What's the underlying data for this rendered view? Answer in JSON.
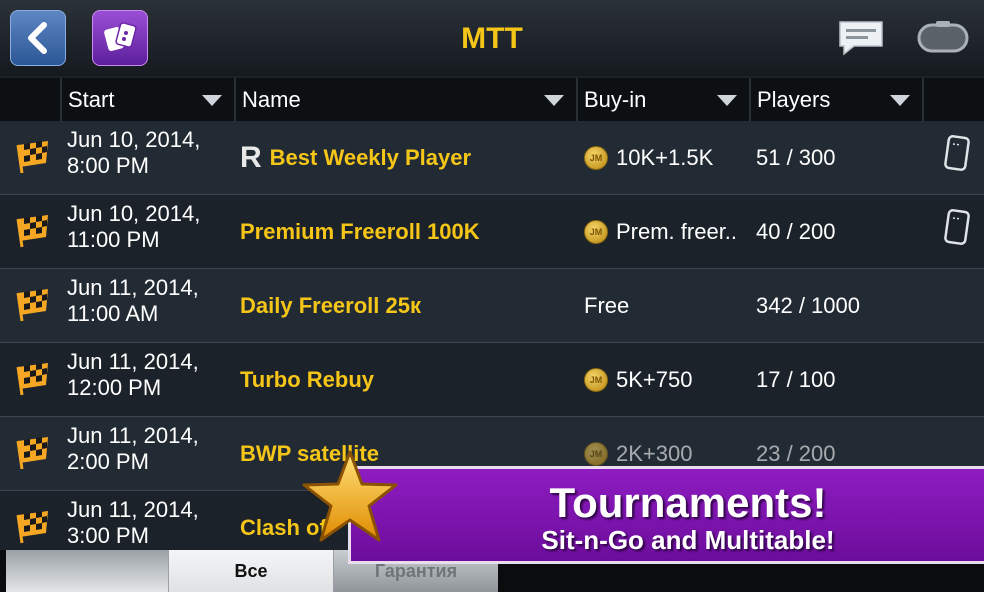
{
  "header": {
    "title": "MTT",
    "back_icon": "chevron-left-icon",
    "cards_icon": "cards-icon",
    "chat_icon": "chat-bubble-icon",
    "toggle_icon": "toggle-icon"
  },
  "columns": [
    {
      "label": "Start"
    },
    {
      "label": "Name"
    },
    {
      "label": "Buy-in"
    },
    {
      "label": "Players"
    }
  ],
  "rows": [
    {
      "start_date": "Jun 10, 2014,",
      "start_time": "8:00 PM",
      "rebuy_mark": "R",
      "name": "Best Weekly Player",
      "coin_label": "JM",
      "buyin": "10K+1.5K",
      "players": "51 / 300"
    },
    {
      "start_date": "Jun 10, 2014,",
      "start_time": "11:00 PM",
      "name": "Premium Freeroll 100K",
      "coin_label": "JM",
      "buyin": "Prem. freer..",
      "players": "40 / 200"
    },
    {
      "start_date": "Jun 11, 2014,",
      "start_time": "11:00 AM",
      "name": "Daily Freeroll 25к",
      "buyin": "Free",
      "players": "342 / 1000"
    },
    {
      "start_date": "Jun 11, 2014,",
      "start_time": "12:00 PM",
      "name": "Turbo Rebuy",
      "coin_label": "JM",
      "buyin": "5K+750",
      "players": "17 / 100"
    },
    {
      "start_date": "Jun 11, 2014,",
      "start_time": "2:00 PM",
      "name": "BWP satellite",
      "coin_label": "JM",
      "buyin": "2K+300",
      "players": "23 / 200"
    },
    {
      "start_date": "Jun 11, 2014,",
      "start_time": "3:00 PM",
      "name": "Clash of"
    }
  ],
  "bottom_tabs": {
    "tab_all": "Все",
    "tab_guarantee": "Гарантия"
  },
  "promo": {
    "title": "Tournaments!",
    "subtitle": "Sit-n-Go and Multitable!"
  },
  "colors": {
    "accent_yellow": "#f5c518",
    "banner_purple": "#8e1cc1",
    "back_blue": "#3b68ab"
  }
}
